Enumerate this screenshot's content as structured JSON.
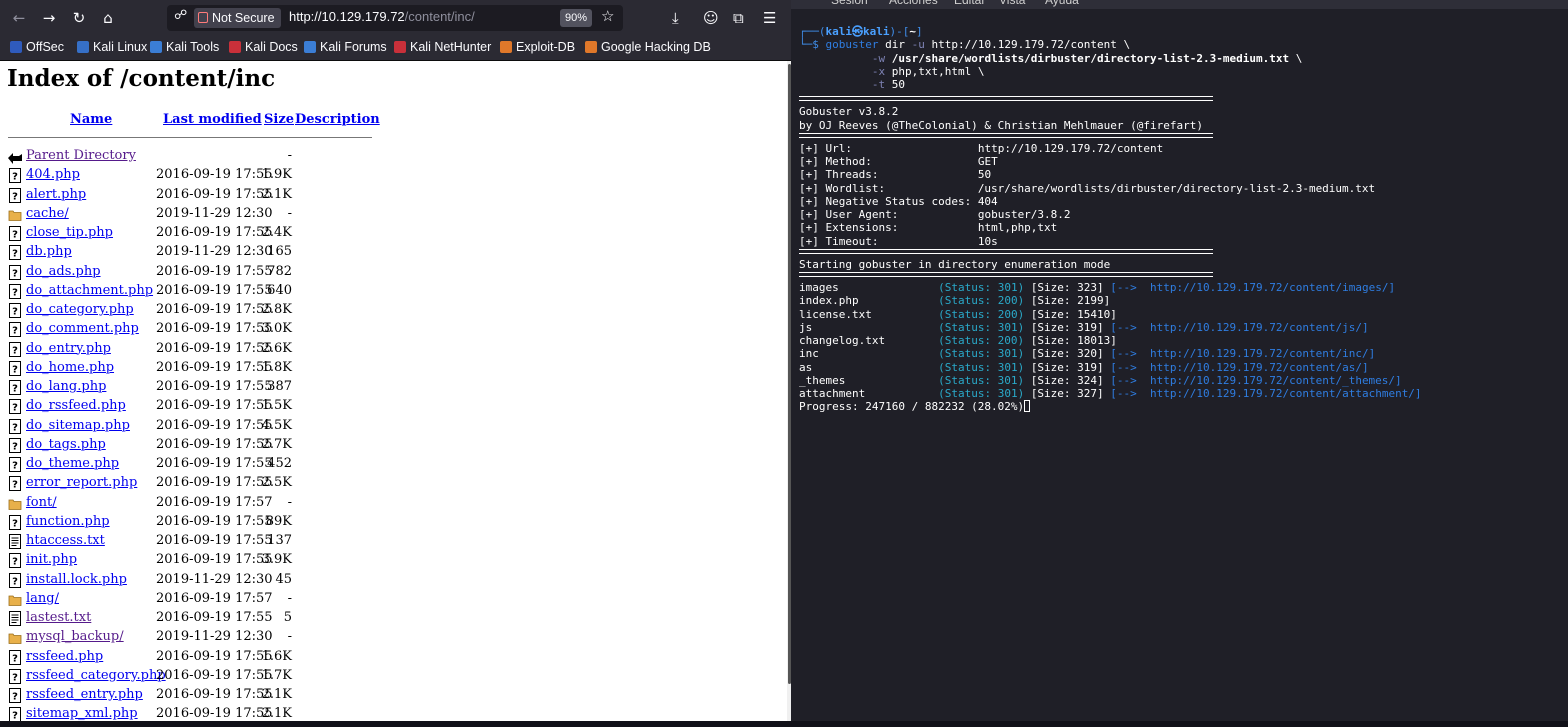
{
  "browser": {
    "security_label": "Not Secure",
    "url_host": "http://10.129.179.72",
    "url_path": "/content/inc/",
    "zoom": "90%",
    "bookmarks": [
      {
        "label": "OffSec",
        "color": "#2f5bbd"
      },
      {
        "label": "Kali Linux",
        "color": "#3670c8"
      },
      {
        "label": "Kali Tools",
        "color": "#3b7ed6"
      },
      {
        "label": "Kali Docs",
        "color": "#c9303a"
      },
      {
        "label": "Kali Forums",
        "color": "#3b7ed6"
      },
      {
        "label": "Kali NetHunter",
        "color": "#c9303a"
      },
      {
        "label": "Exploit-DB",
        "color": "#e0782a"
      },
      {
        "label": "Google Hacking DB",
        "color": "#e0782a"
      }
    ]
  },
  "listing": {
    "title": "Index of /content/inc",
    "headers": {
      "name": "Name",
      "modified": "Last modified",
      "size": "Size",
      "description": "Description"
    },
    "parent": {
      "label": "Parent Directory",
      "size": "-"
    },
    "rows": [
      {
        "name": "404.php",
        "date": "2016-09-19 17:55",
        "size": "1.9K",
        "type": "file"
      },
      {
        "name": "alert.php",
        "date": "2016-09-19 17:55",
        "size": "2.1K",
        "type": "file"
      },
      {
        "name": "cache/",
        "date": "2019-11-29 12:30",
        "size": "-",
        "type": "folder"
      },
      {
        "name": "close_tip.php",
        "date": "2016-09-19 17:55",
        "size": "2.4K",
        "type": "file"
      },
      {
        "name": "db.php",
        "date": "2019-11-29 12:30",
        "size": "165",
        "type": "file"
      },
      {
        "name": "do_ads.php",
        "date": "2016-09-19 17:55",
        "size": "782",
        "type": "file"
      },
      {
        "name": "do_attachment.php",
        "date": "2016-09-19 17:55",
        "size": "640",
        "type": "file"
      },
      {
        "name": "do_category.php",
        "date": "2016-09-19 17:55",
        "size": "2.8K",
        "type": "file"
      },
      {
        "name": "do_comment.php",
        "date": "2016-09-19 17:55",
        "size": "3.0K",
        "type": "file"
      },
      {
        "name": "do_entry.php",
        "date": "2016-09-19 17:55",
        "size": "2.6K",
        "type": "file"
      },
      {
        "name": "do_home.php",
        "date": "2016-09-19 17:55",
        "size": "1.8K",
        "type": "file"
      },
      {
        "name": "do_lang.php",
        "date": "2016-09-19 17:55",
        "size": "387",
        "type": "file"
      },
      {
        "name": "do_rssfeed.php",
        "date": "2016-09-19 17:55",
        "size": "1.5K",
        "type": "file"
      },
      {
        "name": "do_sitemap.php",
        "date": "2016-09-19 17:55",
        "size": "4.5K",
        "type": "file"
      },
      {
        "name": "do_tags.php",
        "date": "2016-09-19 17:55",
        "size": "2.7K",
        "type": "file"
      },
      {
        "name": "do_theme.php",
        "date": "2016-09-19 17:55",
        "size": "452",
        "type": "file"
      },
      {
        "name": "error_report.php",
        "date": "2016-09-19 17:55",
        "size": "2.5K",
        "type": "file"
      },
      {
        "name": "font/",
        "date": "2016-09-19 17:57",
        "size": "-",
        "type": "folder"
      },
      {
        "name": "function.php",
        "date": "2016-09-19 17:55",
        "size": "89K",
        "type": "file"
      },
      {
        "name": "htaccess.txt",
        "date": "2016-09-19 17:55",
        "size": "137",
        "type": "text"
      },
      {
        "name": "init.php",
        "date": "2016-09-19 17:55",
        "size": "3.9K",
        "type": "file"
      },
      {
        "name": "install.lock.php",
        "date": "2019-11-29 12:30",
        "size": "45",
        "type": "file"
      },
      {
        "name": "lang/",
        "date": "2016-09-19 17:57",
        "size": "-",
        "type": "folder"
      },
      {
        "name": "lastest.txt",
        "date": "2016-09-19 17:55",
        "size": "5",
        "type": "text",
        "visited": true
      },
      {
        "name": "mysql_backup/",
        "date": "2019-11-29 12:30",
        "size": "-",
        "type": "folder",
        "visited": true
      },
      {
        "name": "rssfeed.php",
        "date": "2016-09-19 17:55",
        "size": "1.6K",
        "type": "file"
      },
      {
        "name": "rssfeed_category.php",
        "date": "2016-09-19 17:55",
        "size": "1.7K",
        "type": "file"
      },
      {
        "name": "rssfeed_entry.php",
        "date": "2016-09-19 17:55",
        "size": "2.1K",
        "type": "file"
      },
      {
        "name": "sitemap_xml.php",
        "date": "2016-09-19 17:55",
        "size": "2.1K",
        "type": "file"
      }
    ]
  },
  "terminal": {
    "menu": [
      "Sesión",
      "Acciones",
      "Editar",
      "Vista",
      "Ayuda"
    ],
    "prompt_user": "kali",
    "prompt_host": "kali",
    "prompt_at": "㉿",
    "prompt_dir": "~",
    "command": {
      "tool": "gobuster",
      "args1": " dir ",
      "flag_u": "-u",
      "url": " http://10.129.179.72/content \\",
      "flag_w": "-w",
      "wordlist": "/usr/share/wordlists/dirbuster/directory-list-2.3-medium.txt",
      "wordlist_cont": " \\",
      "flag_x": "-x",
      "ext": " php,txt,html \\",
      "flag_t": "-t",
      "threads": " 50"
    },
    "banner": [
      "Gobuster v3.8.2",
      "by OJ Reeves (@TheColonial) & Christian Mehlmauer (@firefart)"
    ],
    "config": [
      {
        "key": "[+] Url:",
        "value": "http://10.129.179.72/content"
      },
      {
        "key": "[+] Method:",
        "value": "GET"
      },
      {
        "key": "[+] Threads:",
        "value": "50"
      },
      {
        "key": "[+] Wordlist:",
        "value": "/usr/share/wordlists/dirbuster/directory-list-2.3-medium.txt"
      },
      {
        "key": "[+] Negative Status codes:",
        "value": "404"
      },
      {
        "key": "[+] User Agent:",
        "value": "gobuster/3.8.2"
      },
      {
        "key": "[+] Extensions:",
        "value": "html,php,txt"
      },
      {
        "key": "[+] Timeout:",
        "value": "10s"
      }
    ],
    "starting": "Starting gobuster in directory enumeration mode",
    "results": [
      {
        "path": "images",
        "status": "(Status: 301)",
        "size": "[Size: 323]",
        "redirect": "[-->  http://10.129.179.72/content/images/]"
      },
      {
        "path": "index.php",
        "status": "(Status: 200)",
        "size": "[Size: 2199]",
        "redirect": ""
      },
      {
        "path": "license.txt",
        "status": "(Status: 200)",
        "size": "[Size: 15410]",
        "redirect": ""
      },
      {
        "path": "js",
        "status": "(Status: 301)",
        "size": "[Size: 319]",
        "redirect": "[-->  http://10.129.179.72/content/js/]"
      },
      {
        "path": "changelog.txt",
        "status": "(Status: 200)",
        "size": "[Size: 18013]",
        "redirect": ""
      },
      {
        "path": "inc",
        "status": "(Status: 301)",
        "size": "[Size: 320]",
        "redirect": "[-->  http://10.129.179.72/content/inc/]"
      },
      {
        "path": "as",
        "status": "(Status: 301)",
        "size": "[Size: 319]",
        "redirect": "[-->  http://10.129.179.72/content/as/]"
      },
      {
        "path": "_themes",
        "status": "(Status: 301)",
        "size": "[Size: 324]",
        "redirect": "[-->  http://10.129.179.72/content/_themes/]"
      },
      {
        "path": "attachment",
        "status": "(Status: 301)",
        "size": "[Size: 327]",
        "redirect": "[-->  http://10.129.179.72/content/attachment/]"
      }
    ],
    "progress": "Progress: 247160 / 882232 (28.02%)"
  }
}
